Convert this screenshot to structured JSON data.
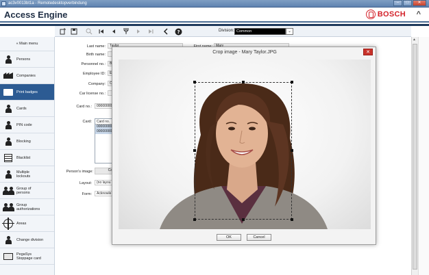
{
  "remote_desktop": {
    "title": "ac3v0013bt1a - Remotedesktopverbindung",
    "minimize": "–",
    "maximize": "□",
    "close": "✕"
  },
  "app": {
    "title": "Access Engine",
    "brand": "BOSCH",
    "collapse_icon": "chevron-up"
  },
  "toolbar": {
    "division_label": "Division:",
    "division_value": "Common"
  },
  "sidebar": {
    "main_menu": "« Main menu",
    "items": [
      {
        "label": "Persons",
        "icon": "person"
      },
      {
        "label": "Companies",
        "icon": "factory"
      },
      {
        "label": "Print badges",
        "icon": "badge",
        "active": true
      },
      {
        "label": "Cards",
        "icon": "person-card"
      },
      {
        "label": "PIN code",
        "icon": "person-pin"
      },
      {
        "label": "Blocking",
        "icon": "person-block"
      },
      {
        "label": "Blacklist",
        "icon": "list"
      },
      {
        "label": "Multiple lockouts",
        "icon": "person-lock"
      },
      {
        "label": "Group of persons",
        "icon": "group"
      },
      {
        "label": "Group authorizations",
        "icon": "group-key"
      },
      {
        "label": "Areas",
        "icon": "target"
      },
      {
        "label": "Change division",
        "icon": "person-switch"
      },
      {
        "label": "PegaSys Stoppage card",
        "icon": "card"
      }
    ]
  },
  "form": {
    "last_name_label": "Last name:",
    "last_name_value": "Taylor",
    "first_name_label": "First name:",
    "first_name_value": "Mary",
    "birth_name_label": "Birth name:",
    "personnel_no_label": "Personnel no.:",
    "personnel_no_value": "B",
    "employee_id_label": "Employee ID:",
    "employee_id_value": "E",
    "company_label": "Company:",
    "company_value": "C",
    "car_license_label": "Car license no.:",
    "card_no_label": "Card no.:",
    "card_no_value": "00000000",
    "card_label": "Card:",
    "card_list_header": "Card no.",
    "card_list_rows": [
      "00000000",
      "00000000"
    ],
    "persons_image_label": "Person's image:",
    "persons_image_button": "Ca",
    "layout_label": "Layout:",
    "layout_value": "(no layou",
    "form_label": "Form:",
    "form_value": "Acknowle"
  },
  "dialog": {
    "title": "Crop image - Mary Taylor.JPG",
    "close": "✕",
    "ok": "OK",
    "cancel": "Cancel"
  }
}
